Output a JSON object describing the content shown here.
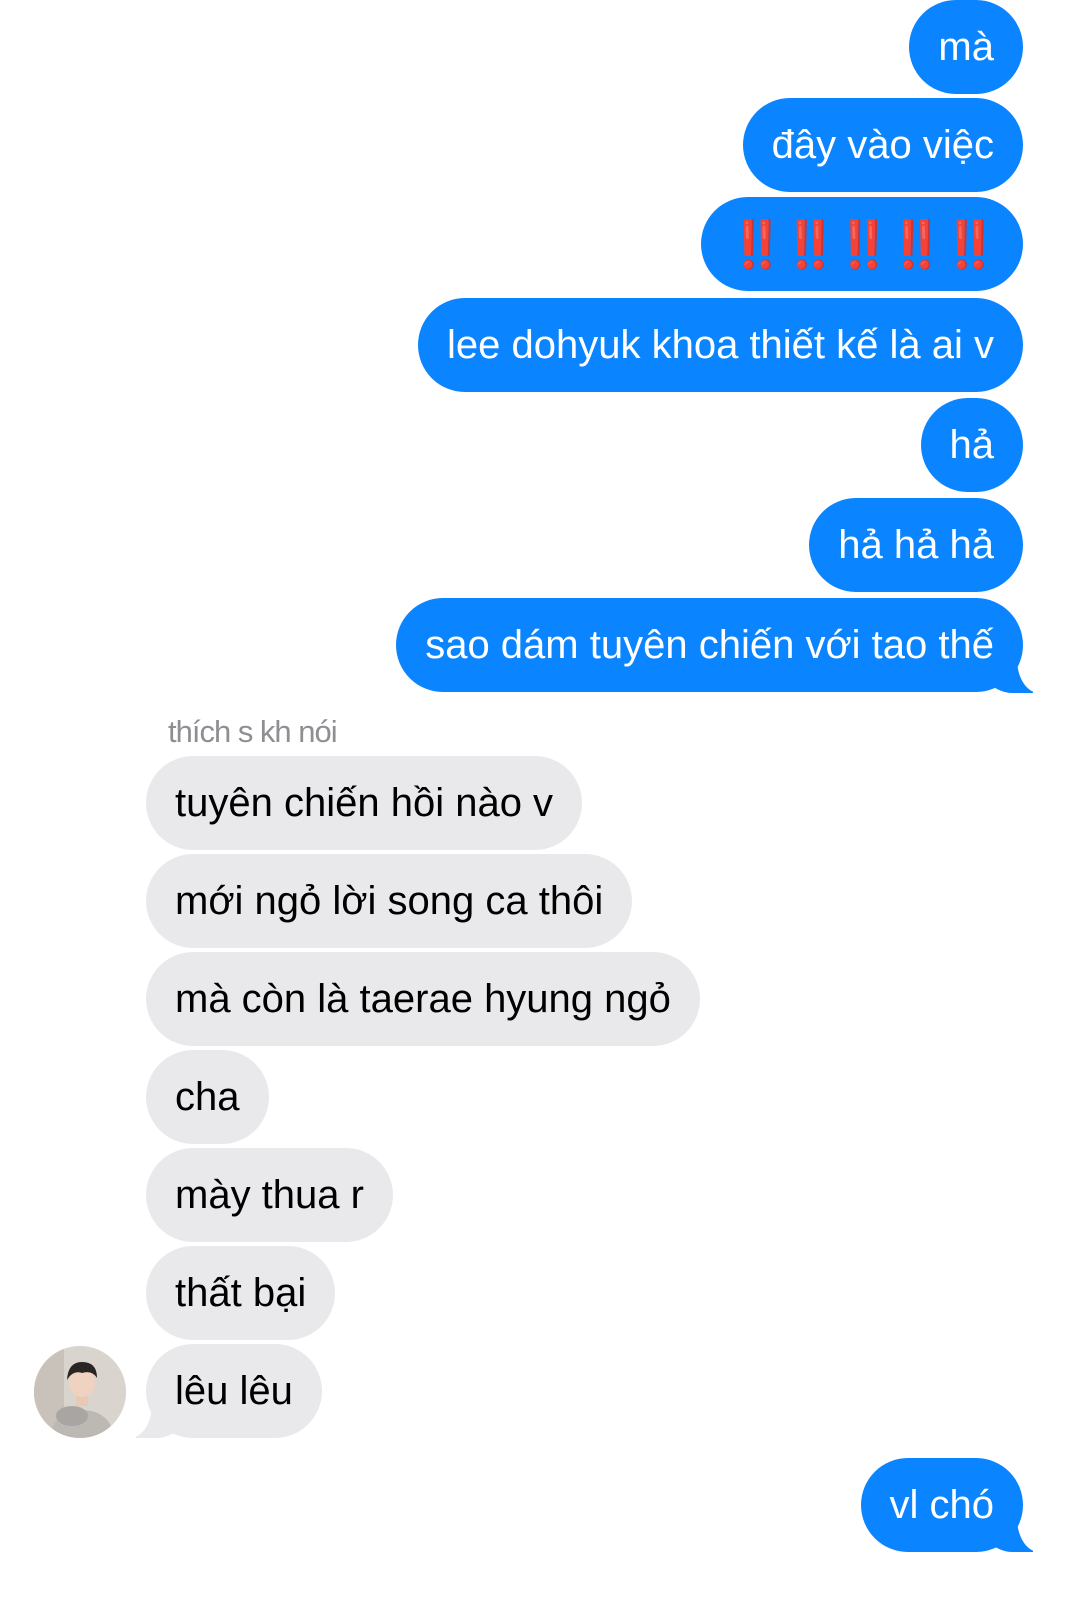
{
  "conversation": {
    "outgoing_block_1": [
      "mà",
      "đây vào việc",
      "‼️‼️‼️‼️‼️",
      "lee dohyuk khoa thiết kế là ai v",
      "hả",
      "hả hả hả",
      "sao dám tuyên chiến với tao thế"
    ],
    "sender_name": "thích s kh nói",
    "incoming": [
      "tuyên chiến hồi nào v",
      "mới ngỏ lời song ca thôi",
      "mà còn là taerae hyung ngỏ",
      "cha",
      "mày thua r",
      "thất bại",
      "lêu lêu"
    ],
    "outgoing_block_2": [
      "vl chó"
    ]
  },
  "colors": {
    "outgoing_bubble": "#0a84ff",
    "incoming_bubble": "#e9e9eb",
    "sender_label": "#8e8e93",
    "emoji_red": "#e8201e"
  },
  "icons": {
    "emoji": "double-exclamation-mark",
    "avatar": "contact-photo"
  }
}
